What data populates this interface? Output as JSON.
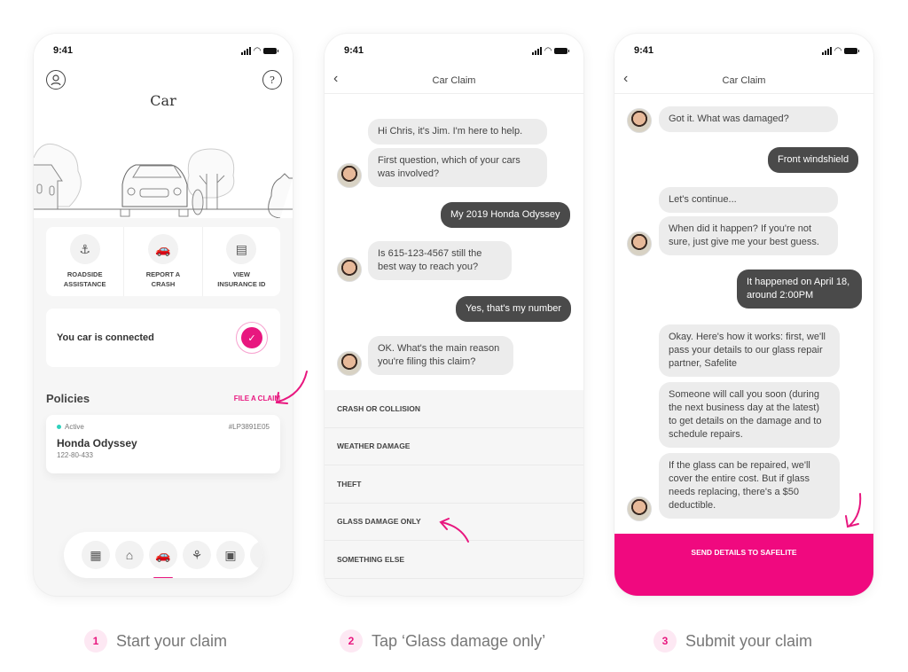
{
  "accent_color": "#e8177f",
  "screens": [
    {
      "status_time": "9:41",
      "title": "Car",
      "header_icons": [
        "profile-icon",
        "help-icon"
      ],
      "actions": [
        {
          "icon": "roadside-assistance-icon",
          "label": "ROADSIDE\nASSISTANCE"
        },
        {
          "icon": "report-crash-icon",
          "label": "REPORT A\nCRASH"
        },
        {
          "icon": "insurance-id-icon",
          "label": "VIEW\nINSURANCE ID"
        }
      ],
      "connected_text": "You car is connected",
      "policies_title": "Policies",
      "file_claim_label": "FILE A CLAIM",
      "policy": {
        "status": "Active",
        "id": "#LP3891E05",
        "name": "Honda Odyssey",
        "number": "122-80-433"
      },
      "tabs": [
        "building-icon",
        "home-icon",
        "car-icon",
        "pet-paw-icon",
        "photo-icon",
        "more-icon"
      ],
      "active_tab": "car-icon"
    },
    {
      "status_time": "9:41",
      "nav_title": "Car Claim",
      "messages": [
        {
          "from": "agent",
          "text": "Hi Chris, it's Jim. I'm here to help."
        },
        {
          "from": "agent",
          "text": "First question, which of your cars was involved?"
        },
        {
          "from": "me",
          "text": "My 2019 Honda Odyssey"
        },
        {
          "from": "agent",
          "text": "Is 615-123-4567 still the best way to reach you?"
        },
        {
          "from": "me",
          "text": "Yes, that's my number"
        },
        {
          "from": "agent",
          "text": "OK. What's the main reason you're filing this claim?"
        }
      ],
      "options": [
        "CRASH OR COLLISION",
        "WEATHER DAMAGE",
        "THEFT",
        "GLASS DAMAGE ONLY",
        "SOMETHING ELSE"
      ]
    },
    {
      "status_time": "9:41",
      "nav_title": "Car Claim",
      "messages": [
        {
          "from": "agent",
          "text": "Got it. What was damaged?"
        },
        {
          "from": "me",
          "text": "Front windshield"
        },
        {
          "from": "agent",
          "text": "Let's continue..."
        },
        {
          "from": "agent",
          "text": "When did it happen? If you're not sure, just give me your best guess."
        },
        {
          "from": "me",
          "text": "It happened on April 18, around 2:00PM"
        },
        {
          "from": "agent",
          "text": "Okay. Here's how it works: first, we'll pass your details to our glass repair partner, Safelite"
        },
        {
          "from": "agent",
          "text": "Someone will call you soon (during the next business day at the latest) to get details on the damage and to schedule repairs."
        },
        {
          "from": "agent",
          "text": "If the glass can be repaired, we'll cover the entire cost. But if glass needs replacing, there's a $50 deductible."
        }
      ],
      "cta_label": "SEND DETAILS TO SAFELITE"
    }
  ],
  "captions": [
    {
      "num": "1",
      "text": "Start your claim"
    },
    {
      "num": "2",
      "text": "Tap ‘Glass damage only’"
    },
    {
      "num": "3",
      "text": "Submit your claim"
    }
  ]
}
